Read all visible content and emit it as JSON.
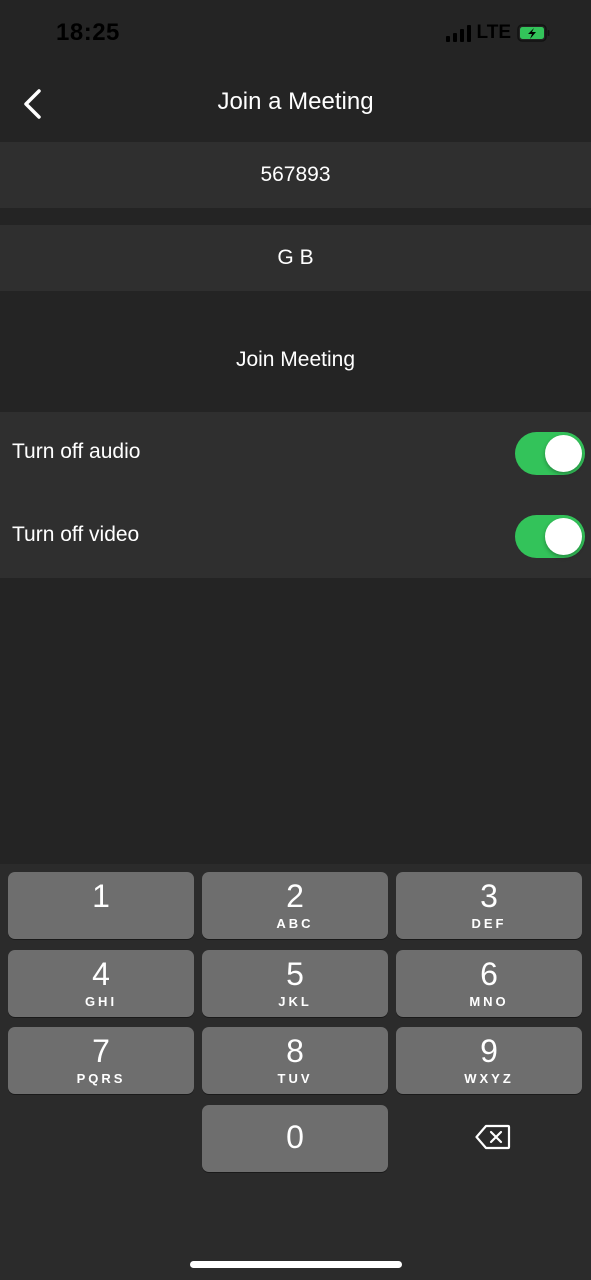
{
  "status_bar": {
    "time": "18:25",
    "network": "LTE",
    "icons": [
      "signal-icon",
      "battery-charging-icon"
    ]
  },
  "nav": {
    "title": "Join a Meeting",
    "back_icon": "chevron-left-icon"
  },
  "meeting_id": {
    "value": "567893"
  },
  "display_name": {
    "value": "G B"
  },
  "join_button": {
    "label": "Join Meeting"
  },
  "options": [
    {
      "label": "Turn off audio",
      "on": true
    },
    {
      "label": "Turn off video",
      "on": true
    }
  ],
  "colors": {
    "background": "#242424",
    "row": "#2f2f2f",
    "toggle_on": "#33c35a",
    "key": "#6e6e6e",
    "keypad": "#2b2b2b"
  },
  "keypad": {
    "keys": [
      {
        "digit": "1",
        "letters": ""
      },
      {
        "digit": "2",
        "letters": "ABC"
      },
      {
        "digit": "3",
        "letters": "DEF"
      },
      {
        "digit": "4",
        "letters": "GHI"
      },
      {
        "digit": "5",
        "letters": "JKL"
      },
      {
        "digit": "6",
        "letters": "MNO"
      },
      {
        "digit": "7",
        "letters": "PQRS"
      },
      {
        "digit": "8",
        "letters": "TUV"
      },
      {
        "digit": "9",
        "letters": "WXYZ"
      },
      {
        "digit": "0",
        "letters": ""
      }
    ],
    "backspace_icon": "backspace-icon"
  }
}
